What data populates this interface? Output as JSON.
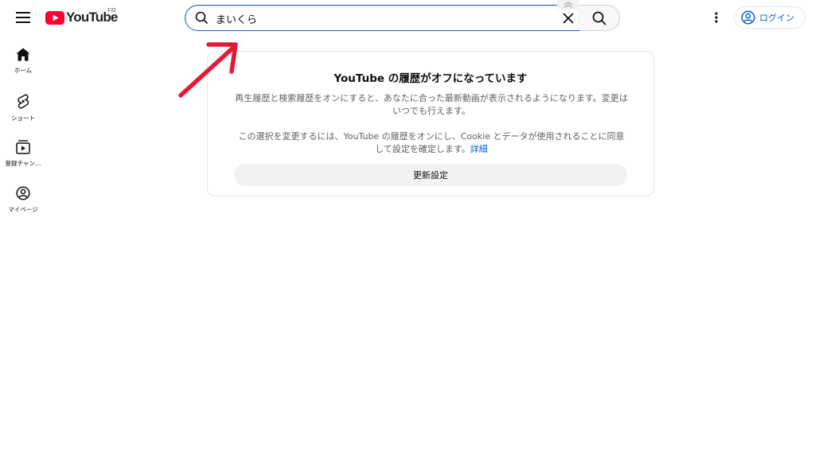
{
  "header": {
    "logo_text": "YouTube",
    "country_code": "FR",
    "search": {
      "value": "まいくら",
      "placeholder": ""
    },
    "login_label": "ログイン"
  },
  "sidebar": {
    "items": [
      {
        "label": "ホーム",
        "icon": "home-icon"
      },
      {
        "label": "ショート",
        "icon": "shorts-icon"
      },
      {
        "label": "登録チャン…",
        "icon": "subscriptions-icon"
      },
      {
        "label": "マイページ",
        "icon": "you-icon"
      }
    ]
  },
  "card": {
    "title": "YouTube の履歴がオフになっています",
    "paragraph1": "再生履歴と検索履歴をオンにすると、あなたに合った最新動画が表示されるようになります。変更はいつでも行えます。",
    "paragraph2": "この選択を変更するには、YouTube の履歴をオンにし、Cookie とデータが使用されることに同意して設定を確定します。",
    "learn_more": "詳細",
    "update_button": "更新設定"
  },
  "colors": {
    "brand_red": "#ff0033",
    "link_blue": "#065fd4",
    "search_focus": "#1c62b9",
    "annotation_red": "#e31937"
  }
}
